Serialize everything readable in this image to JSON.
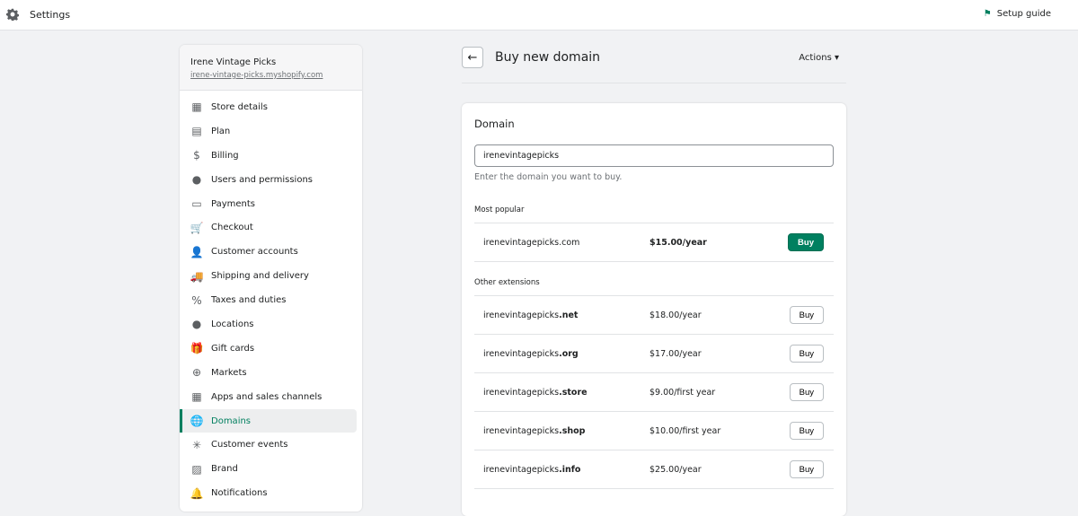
{
  "topbar": {
    "title": "Settings",
    "setup_guide": "Setup guide"
  },
  "store": {
    "name": "Irene Vintage Picks",
    "url": "irene-vintage-picks.myshopify.com"
  },
  "nav": [
    {
      "label": "Store details",
      "icon": "store-icon",
      "glyph": "▦"
    },
    {
      "label": "Plan",
      "icon": "plan-icon",
      "glyph": "▤"
    },
    {
      "label": "Billing",
      "icon": "billing-icon",
      "glyph": "$"
    },
    {
      "label": "Users and permissions",
      "icon": "user-circle-icon",
      "glyph": "●"
    },
    {
      "label": "Payments",
      "icon": "credit-card-icon",
      "glyph": "▭"
    },
    {
      "label": "Checkout",
      "icon": "cart-icon",
      "glyph": "🛒"
    },
    {
      "label": "Customer accounts",
      "icon": "person-icon",
      "glyph": "👤"
    },
    {
      "label": "Shipping and delivery",
      "icon": "truck-icon",
      "glyph": "🚚"
    },
    {
      "label": "Taxes and duties",
      "icon": "tax-icon",
      "glyph": "%"
    },
    {
      "label": "Locations",
      "icon": "location-pin-icon",
      "glyph": "●"
    },
    {
      "label": "Gift cards",
      "icon": "gift-icon",
      "glyph": "🎁"
    },
    {
      "label": "Markets",
      "icon": "globe-icon",
      "glyph": "⊕"
    },
    {
      "label": "Apps and sales channels",
      "icon": "apps-icon",
      "glyph": "▦"
    },
    {
      "label": "Domains",
      "icon": "globe-icon",
      "glyph": "🌐",
      "active": true
    },
    {
      "label": "Customer events",
      "icon": "cursor-click-icon",
      "glyph": "✳"
    },
    {
      "label": "Brand",
      "icon": "brand-icon",
      "glyph": "▨"
    },
    {
      "label": "Notifications",
      "icon": "bell-icon",
      "glyph": "🔔"
    }
  ],
  "header": {
    "title": "Buy new domain",
    "actions": "Actions ▾"
  },
  "card": {
    "title": "Domain",
    "input_value": "irenevintagepicks",
    "help": "Enter the domain you want to buy.",
    "most_popular": "Most popular",
    "other": "Other extensions",
    "buy": "Buy",
    "popular": {
      "base": "irenevintagepicks",
      "ext": ".com",
      "price": "$15.00/year"
    },
    "others": [
      {
        "base": "irenevintagepicks",
        "ext": ".net",
        "price": "$18.00/year"
      },
      {
        "base": "irenevintagepicks",
        "ext": ".org",
        "price": "$17.00/year"
      },
      {
        "base": "irenevintagepicks",
        "ext": ".store",
        "price": "$9.00/first year"
      },
      {
        "base": "irenevintagepicks",
        "ext": ".shop",
        "price": "$10.00/first year"
      },
      {
        "base": "irenevintagepicks",
        "ext": ".info",
        "price": "$25.00/year"
      }
    ]
  },
  "colors": {
    "primary": "#008060",
    "active_nav": "#007f5f"
  }
}
